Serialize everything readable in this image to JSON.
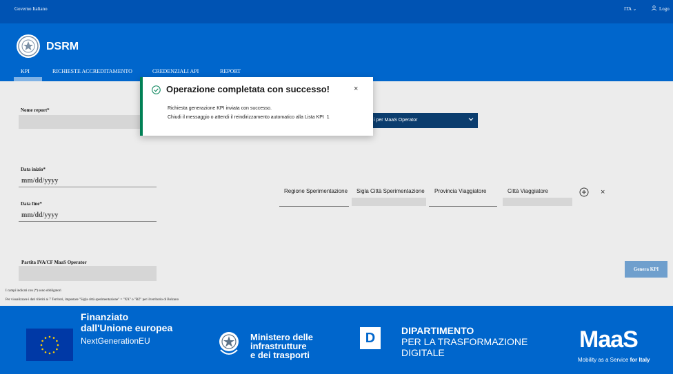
{
  "topbar": {
    "gov_label": "Governo Italiano",
    "lang": "ITA ⌄",
    "login": "Logo"
  },
  "header": {
    "brand": "DSRM"
  },
  "nav": {
    "items": [
      "KPI",
      "RICHIESTE ACCREDITAMENTO",
      "CREDENZIALI API",
      "REPORT"
    ],
    "active": "KPI"
  },
  "form": {
    "nome_report_label": "Nome report*",
    "dropdown_text": "i per MaaS Operator",
    "data_inizio_label": "Data inizio*",
    "data_inizio_placeholder": "mm/dd/yyyy",
    "data_fine_label": "Data fine*",
    "data_fine_placeholder": "mm/dd/yyyy",
    "columns": [
      "Regione Sperimentazione",
      "Sigla Città Sperimentazione",
      "Provincia Viaggiatore",
      "Città Viaggiatore"
    ],
    "partita_label": "Partita IVA/CF MaaS Operator",
    "genera_button": "Genera KPI",
    "note_1": "I campi indicati con (*) sono obbligatori",
    "note_2": "Per visualizzare i dati riferiti ai 7 Territori, impostare \"Sigla città sperimentazione\" = \"XX\" o \"BZ\" per il territorio di Bolzano"
  },
  "toast": {
    "title": "Operazione completata con successo!",
    "line1": "Richiesta generazione KPI inviata con successo.",
    "line2": "Chiudi il messaggio o attendi il reindirizzamento automatico alla Lista KPI",
    "countdown": "1",
    "close": "×"
  },
  "footer": {
    "eu_title": "Finanziato",
    "eu_subtitle": "dall'Unione europea",
    "eu_ng": "NextGenerationEU",
    "mit_lines": [
      "Ministero delle",
      "infrastrutture",
      "e dei trasporti"
    ],
    "dpt_letter": "D",
    "dpt_title": "DIPARTIMENTO",
    "dpt_lines": [
      "PER LA TRASFORMAZIONE",
      "DIGITALE"
    ],
    "maas_logo": "MaaS",
    "maas_tag_1": "Mobility as a Service ",
    "maas_tag_2": "for Italy"
  },
  "colors": {
    "primary": "#0066cc",
    "topbar": "#0053b3",
    "dropdown": "#0b3d6e",
    "success": "#008055",
    "button": "#6f9fcd"
  },
  "icons": [
    "user-icon",
    "emblem-icon",
    "chevron-down-icon",
    "plus-circle-icon",
    "close-icon",
    "check-circle-icon",
    "eu-flag-icon",
    "mit-emblem-icon"
  ]
}
